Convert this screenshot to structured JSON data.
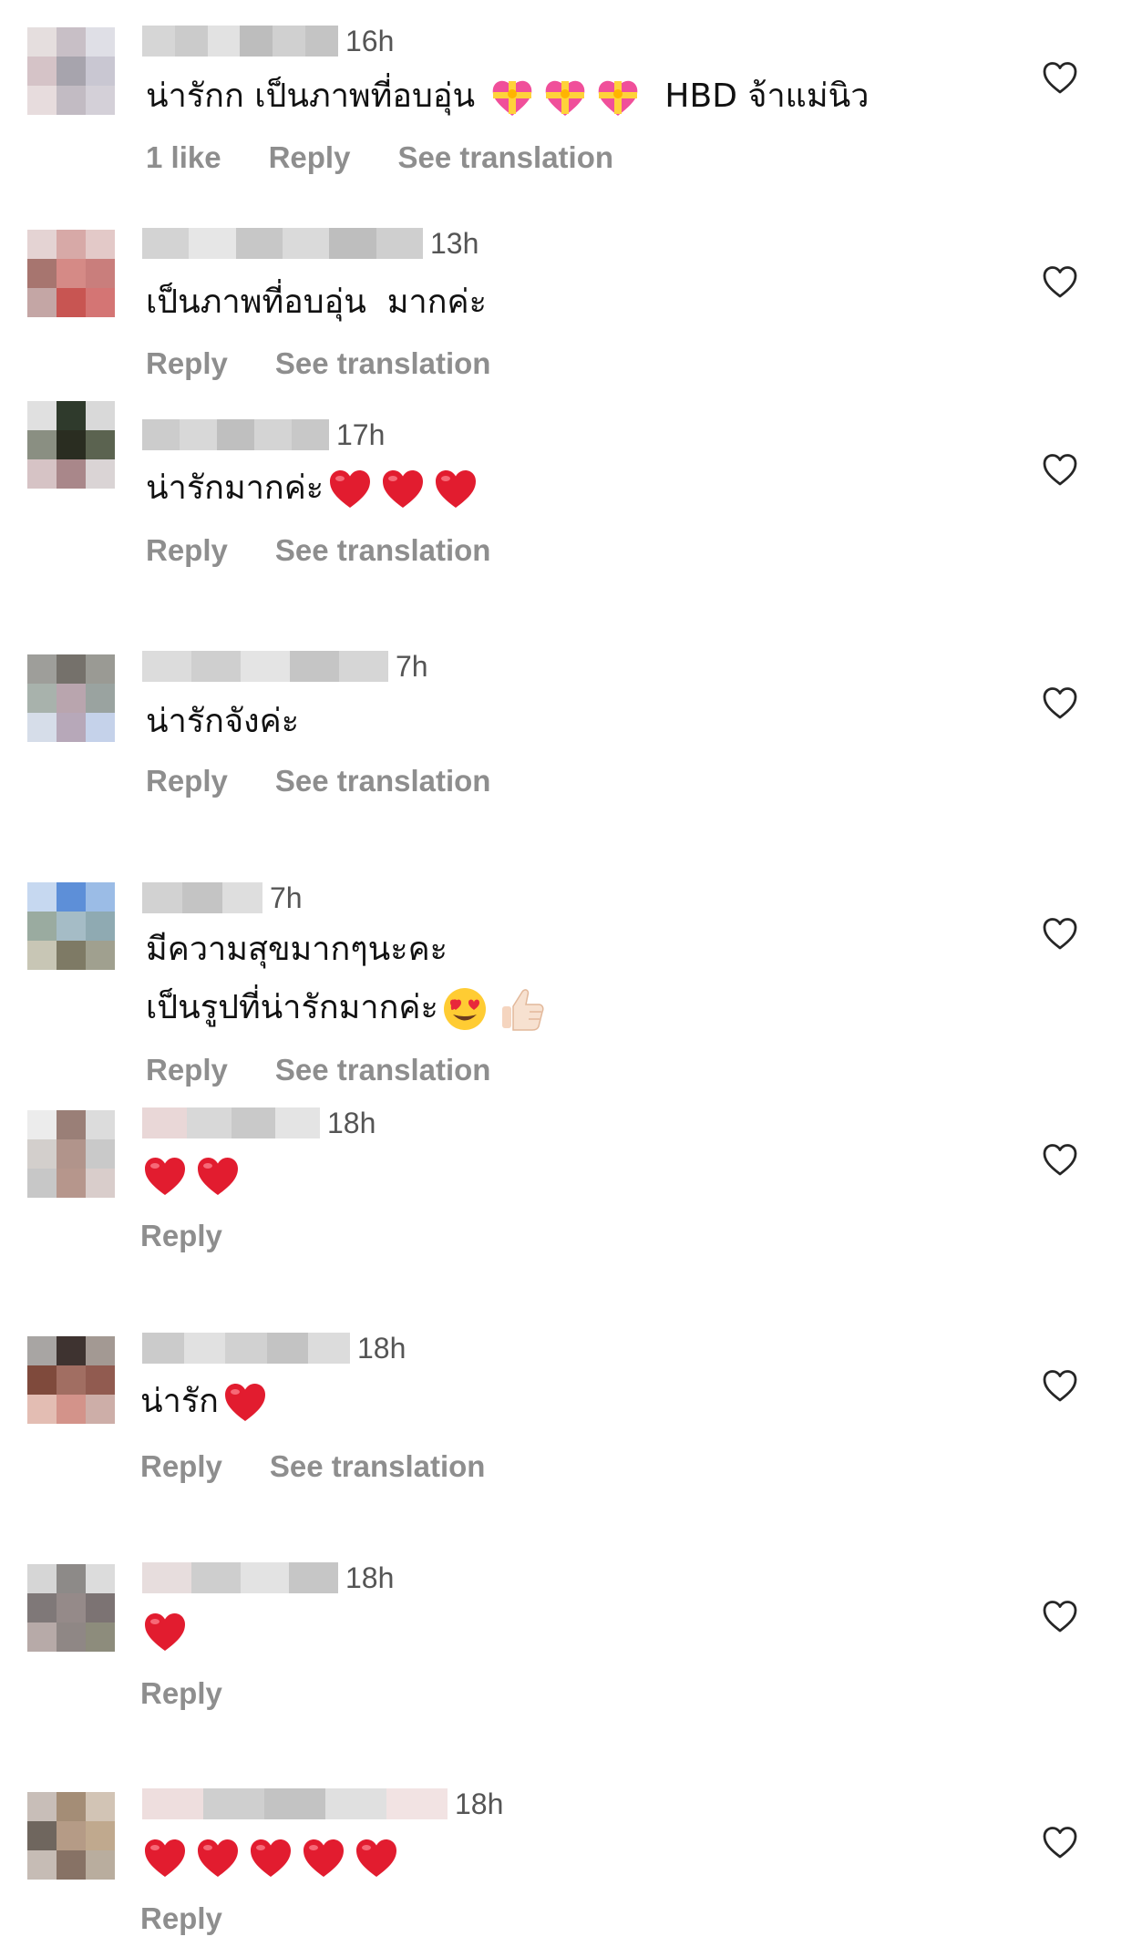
{
  "comments": [
    {
      "time": "16h",
      "text": "น่ารักก เป็นภาพที่อบอุ่น",
      "text_suffix": "HBD จ้าแม่นิว",
      "emoji_count": 3,
      "likes_label": "1 like",
      "reply_label": "Reply",
      "translate_label": "See translation",
      "avatar_colors": [
        "#e5dede",
        "#c8bfc6",
        "#dfdfe6",
        "#d5c3c7",
        "#a7a4ad",
        "#c9c7d2",
        "#e7dcdd",
        "#c2bbc3",
        "#d4d0d8"
      ],
      "name_segments": [
        "#d6d6d6",
        "#cbcbcb",
        "#e2e2e2",
        "#bdbdbd",
        "#d0d0d0",
        "#c4c4c4"
      ]
    },
    {
      "time": "13h",
      "text": "เป็นภาพที่อบอุ่น  มากค่ะ",
      "reply_label": "Reply",
      "translate_label": "See translation",
      "avatar_colors": [
        "#e4d3d3",
        "#d7a9a7",
        "#e3c9c8",
        "#a7756f",
        "#d58a86",
        "#c97e7c",
        "#c4a6a5",
        "#c85552",
        "#d47574"
      ],
      "name_segments": [
        "#d3d3d3",
        "#e6e6e6",
        "#c7c7c7",
        "#dadada",
        "#bebebe",
        "#cfcfcf"
      ]
    },
    {
      "time": "17h",
      "text": "น่ารักมากค่ะ",
      "heart_count": 3,
      "reply_label": "Reply",
      "translate_label": "See translation",
      "avatar_colors": [
        "#e0e0e0",
        "#2f3a2c",
        "#d9d9d9",
        "#8a8f82",
        "#2a2d21",
        "#5b6350",
        "#d6c3c5",
        "#a9878a",
        "#dad4d5"
      ],
      "name_segments": [
        "#cccccc",
        "#d8d8d8",
        "#bfbfbf",
        "#d4d4d4",
        "#c8c8c8"
      ]
    },
    {
      "time": "7h",
      "text": "น่ารักจังค่ะ",
      "reply_label": "Reply",
      "translate_label": "See translation",
      "avatar_colors": [
        "#9e9e9a",
        "#75716b",
        "#9a9a94",
        "#a8b2ac",
        "#b9a5ae",
        "#9aa3a0",
        "#d6dde9",
        "#b7a8b9",
        "#c5d2ea"
      ],
      "name_segments": [
        "#dcdcdc",
        "#cfcfcf",
        "#e4e4e4",
        "#c5c5c5",
        "#d6d6d6"
      ]
    },
    {
      "time": "7h",
      "text": "มีความสุขมากๆนะคะ",
      "text_line2": "เป็นรูปที่น่ารักมากค่ะ",
      "reply_label": "Reply",
      "translate_label": "See translation",
      "avatar_colors": [
        "#c6d8f0",
        "#5d8fd8",
        "#9bbce6",
        "#9aaba0",
        "#a5bcc6",
        "#8faab2",
        "#c8c6b5",
        "#7e7a65",
        "#a0a08f"
      ],
      "name_segments": [
        "#d2d2d2",
        "#c4c4c4",
        "#dedede"
      ]
    },
    {
      "time": "18h",
      "heart_count": 2,
      "reply_label": "Reply",
      "avatar_colors": [
        "#ececec",
        "#9a7f77",
        "#dcdcdc",
        "#d3cfcc",
        "#b1948b",
        "#c9c9c9",
        "#c7c7c7",
        "#b6968c",
        "#d9cdcb"
      ],
      "name_segments": [
        "#e9d7d7",
        "#d8d8d8",
        "#c9c9c9",
        "#e4e4e4"
      ]
    },
    {
      "time": "18h",
      "text": "น่ารัก",
      "heart_count": 1,
      "reply_label": "Reply",
      "translate_label": "See translation",
      "avatar_colors": [
        "#a8a5a3",
        "#3e3330",
        "#a39993",
        "#7f4a3c",
        "#a16e62",
        "#915b50",
        "#e3bdb3",
        "#d3938a",
        "#cdaea8"
      ],
      "name_segments": [
        "#cbcbcb",
        "#e1e1e1",
        "#d1d1d1",
        "#c3c3c3",
        "#dcdcdc"
      ]
    },
    {
      "time": "18h",
      "heart_count": 1,
      "reply_label": "Reply",
      "avatar_colors": [
        "#d6d6d6",
        "#8d8a88",
        "#dcdcdc",
        "#7f7878",
        "#958a89",
        "#7c7373",
        "#b7aaa8",
        "#8f8785",
        "#8d8c7c"
      ],
      "name_segments": [
        "#e7dddd",
        "#cecece",
        "#e3e3e3",
        "#c6c6c6"
      ]
    },
    {
      "time": "18h",
      "heart_count": 5,
      "reply_label": "Reply",
      "avatar_colors": [
        "#c8beb8",
        "#a48d76",
        "#d2c4b5",
        "#6f665e",
        "#b59b86",
        "#c0a98e",
        "#c6bcb5",
        "#877265",
        "#b9ad9e"
      ],
      "name_segments": [
        "#eedede",
        "#cfcfcf",
        "#c3c3c3",
        "#e0e0e0",
        "#f2e3e3"
      ]
    }
  ],
  "colors": {
    "meta_text": "#8e8e8e",
    "time_text": "#555555",
    "heart_emoji": "#e21c2f",
    "like_outline": "#262626"
  }
}
